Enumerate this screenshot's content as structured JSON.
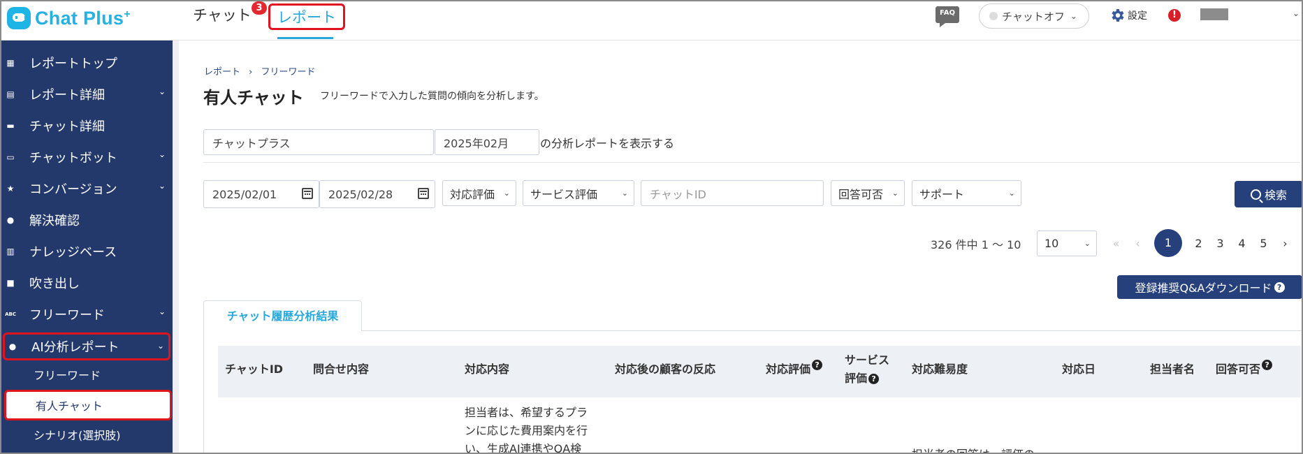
{
  "app": {
    "logo_text": "Chat Plus",
    "logo_sup": "+"
  },
  "header": {
    "nav_chat": "チャット",
    "nav_chat_badge": "3",
    "nav_report": "レポート",
    "faq": "FAQ",
    "chat_status": "チャットオフ",
    "settings": "設定",
    "alert": "!"
  },
  "sidebar": {
    "items": [
      {
        "label": "レポートトップ",
        "icon": "dashboard-icon"
      },
      {
        "label": "レポート詳細",
        "icon": "report-detail-icon"
      },
      {
        "label": "チャット詳細",
        "icon": "chat-icon"
      },
      {
        "label": "チャットボット",
        "icon": "chatbot-icon"
      },
      {
        "label": "コンバージョン",
        "icon": "star-icon"
      },
      {
        "label": "解決確認",
        "icon": "lightbulb-icon"
      },
      {
        "label": "ナレッジベース",
        "icon": "book-icon"
      },
      {
        "label": "吹き出し",
        "icon": "speech-bubble-icon"
      },
      {
        "label": "フリーワード",
        "icon": "abc-icon"
      },
      {
        "label": "AI分析レポート",
        "icon": "lightbulb-icon"
      }
    ],
    "subitems": [
      {
        "label": "フリーワード"
      },
      {
        "label": "有人チャット"
      },
      {
        "label": "シナリオ(選択肢)"
      }
    ]
  },
  "breadcrumb": {
    "root": "レポート",
    "separator": "›",
    "current": "フリーワード"
  },
  "page": {
    "title": "有人チャット",
    "description": "フリーワードで入力した質問の傾向を分析します。"
  },
  "report_form": {
    "site": "チャットプラス",
    "month": "2025年02月",
    "suffix": "の分析レポートを表示する"
  },
  "filters": {
    "date_from": "2025/02/01",
    "date_to": "2025/02/28",
    "response_rating": "対応評価",
    "service_rating": "サービス評価",
    "chat_id_placeholder": "チャットID",
    "answerable": "回答可否",
    "support": "サポート",
    "search": "検索"
  },
  "pagination": {
    "summary": "326 件中 1 ～ 10",
    "page_size": "10",
    "first": "«",
    "prev": "‹",
    "pages": [
      "1",
      "2",
      "3",
      "4",
      "5"
    ],
    "next": "›",
    "last": "»"
  },
  "download_button": "登録推奨Q&Aダウンロード",
  "tab": {
    "label": "チャット履歴分析結果"
  },
  "table": {
    "headers": [
      "チャットID",
      "問合せ内容",
      "対応内容",
      "対応後の顧客の反応",
      "対応評価",
      "サービス",
      "評価",
      "対応難易度",
      "対応日",
      "担当者名",
      "回答可否"
    ],
    "row": {
      "response_lines": [
        "担当者は、希望するプラ",
        "ンに応じた費用案内を行",
        "い、生成AI連携やQA検"
      ],
      "difficulty_partial": "担当者の回答は、評価の"
    }
  },
  "colors": {
    "sidebar": "#24396b",
    "accent": "#27a7da",
    "primary": "#25407a",
    "highlight": "#e0141e"
  }
}
